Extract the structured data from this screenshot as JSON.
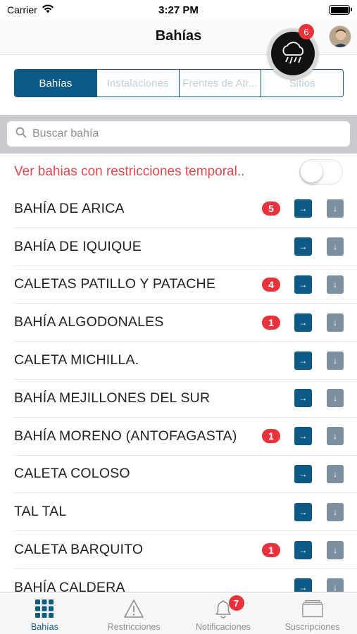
{
  "status_bar": {
    "carrier": "Carrier",
    "time": "3:27 PM"
  },
  "nav": {
    "title": "Bahías",
    "weather_badge": "6"
  },
  "segments": [
    {
      "label": "Bahías",
      "active": true
    },
    {
      "label": "Instalaciones",
      "active": false
    },
    {
      "label": "Frentes de Atr...",
      "active": false
    },
    {
      "label": "Sitios",
      "active": false
    }
  ],
  "search": {
    "placeholder": "Buscar bahía",
    "value": ""
  },
  "filter": {
    "label": "Ver bahias con restricciones temporal..",
    "enabled": false
  },
  "list": [
    {
      "name": "BAHÍA DE ARICA",
      "badge": "5"
    },
    {
      "name": "BAHÍA DE IQUIQUE",
      "badge": ""
    },
    {
      "name": "CALETAS PATILLO Y PATACHE",
      "badge": "4"
    },
    {
      "name": "BAHÍA ALGODONALES",
      "badge": "1"
    },
    {
      "name": "CALETA MICHILLA.",
      "badge": ""
    },
    {
      "name": "BAHÍA MEJILLONES DEL SUR",
      "badge": ""
    },
    {
      "name": "BAHÍA MORENO (ANTOFAGASTA)",
      "badge": "1"
    },
    {
      "name": "CALETA COLOSO",
      "badge": ""
    },
    {
      "name": "TAL TAL",
      "badge": ""
    },
    {
      "name": "CALETA BARQUITO",
      "badge": "1"
    },
    {
      "name": "BAHÍA CALDERA",
      "badge": ""
    }
  ],
  "list_icons": {
    "go": "arrow-right-icon",
    "download": "arrow-down-icon",
    "go_glyph": "→",
    "download_glyph": "↓"
  },
  "tabs": [
    {
      "label": "Bahías",
      "icon": "grid-icon",
      "active": true,
      "badge": ""
    },
    {
      "label": "Restricciones",
      "icon": "warning-icon",
      "active": false,
      "badge": ""
    },
    {
      "label": "Notificaciones",
      "icon": "bell-icon",
      "active": false,
      "badge": "7"
    },
    {
      "label": "Suscripciones",
      "icon": "folders-icon",
      "active": false,
      "badge": ""
    }
  ],
  "colors": {
    "primary": "#0d5a87",
    "danger": "#e8323c",
    "filter_text": "#e0474c",
    "secondary_button": "#7d909f"
  }
}
